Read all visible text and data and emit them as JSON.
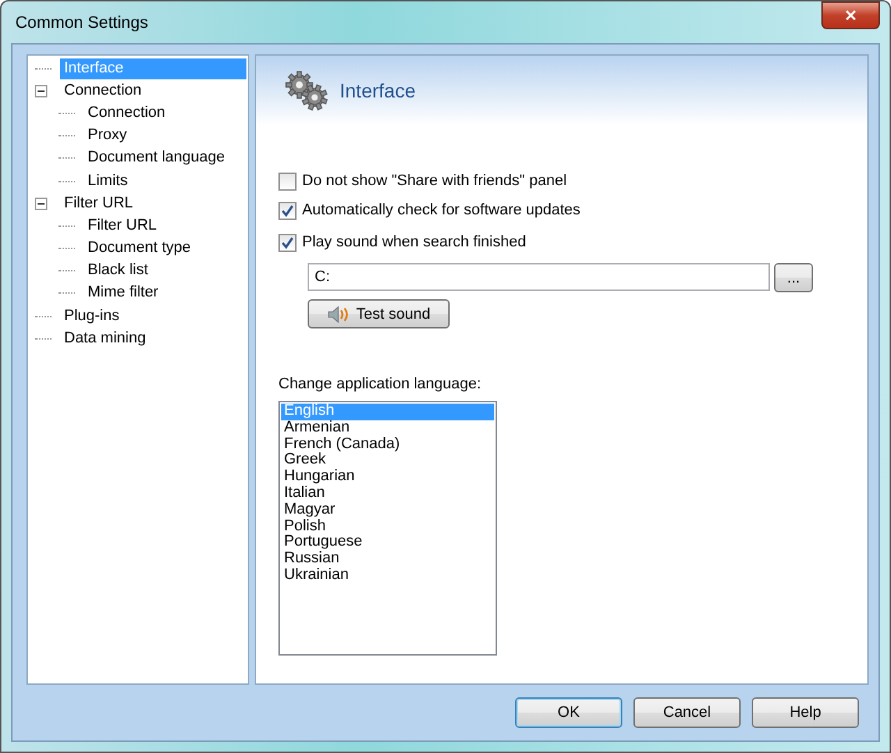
{
  "window": {
    "title": "Common Settings",
    "close": "✕"
  },
  "tree": [
    {
      "label": "Interface",
      "selected": true
    },
    {
      "label": "Connection",
      "selected": false,
      "expanded": true,
      "children": [
        {
          "label": "Connection",
          "selected": false
        },
        {
          "label": "Proxy",
          "selected": false
        },
        {
          "label": "Document language",
          "selected": false
        },
        {
          "label": "Limits",
          "selected": false
        }
      ]
    },
    {
      "label": "Filter URL",
      "selected": false,
      "expanded": true,
      "children": [
        {
          "label": "Filter URL",
          "selected": false
        },
        {
          "label": "Document type",
          "selected": false
        },
        {
          "label": "Black list",
          "selected": false
        },
        {
          "label": "Mime filter",
          "selected": false
        }
      ]
    },
    {
      "label": "Plug-ins",
      "selected": false
    },
    {
      "label": "Data mining",
      "selected": false
    }
  ],
  "panel": {
    "title": "Interface",
    "options": [
      {
        "label": "Do not show \"Share with friends\" panel",
        "checked": false
      },
      {
        "label": "Automatically check for software updates",
        "checked": true
      },
      {
        "label": "Play sound when search finished",
        "checked": true
      }
    ],
    "sound_path": {
      "value": "C:",
      "browse": "..."
    },
    "test_button": "Test sound",
    "language_label": "Change application language:",
    "languages": [
      {
        "label": "English",
        "selected": true
      },
      {
        "label": "Armenian",
        "selected": false
      },
      {
        "label": "French (Canada)",
        "selected": false
      },
      {
        "label": "Greek",
        "selected": false
      },
      {
        "label": "Hungarian",
        "selected": false
      },
      {
        "label": "Italian",
        "selected": false
      },
      {
        "label": "Magyar",
        "selected": false
      },
      {
        "label": "Polish",
        "selected": false
      },
      {
        "label": "Portuguese",
        "selected": false
      },
      {
        "label": "Russian",
        "selected": false
      },
      {
        "label": "Ukrainian",
        "selected": false
      }
    ]
  },
  "buttons": [
    {
      "label": "OK",
      "kind": "default"
    },
    {
      "label": "Cancel",
      "kind": "normal"
    },
    {
      "label": "Help",
      "kind": "normal"
    }
  ]
}
